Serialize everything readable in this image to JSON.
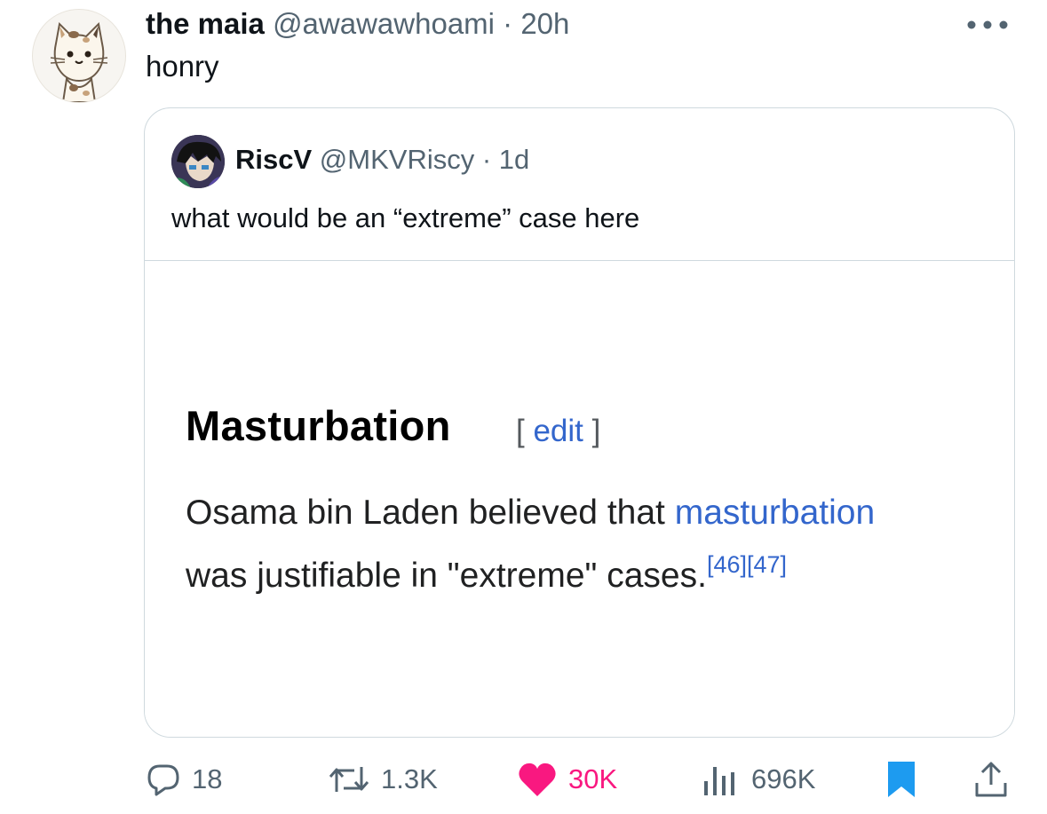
{
  "tweet": {
    "display_name": "the maia",
    "handle": "@awawawhoami",
    "separator": " · ",
    "time": "20h",
    "text": "honry",
    "avatar_icon": "cat-avatar-icon",
    "more_icon": "more-dots-icon"
  },
  "quoted": {
    "display_name": "RiscV",
    "handle": "@MKVRiscy",
    "separator": " · ",
    "time": "1d",
    "text": "what would be an “extreme” case here",
    "avatar_icon": "anime-avatar-icon",
    "image": {
      "heading": "Masturbation",
      "edit_open": "[ ",
      "edit_label": "edit",
      "edit_close": " ]",
      "line1_text": "Osama bin Laden believed that ",
      "line1_link": "masturbation",
      "line2_text": "was justifiable in \"extreme\" cases.",
      "refs": "[46][47]"
    }
  },
  "actions": {
    "reply_count": "18",
    "retweet_count": "1.3K",
    "like_count": "30K",
    "views_count": "696K",
    "like_color": "#f91880",
    "bookmark_color": "#1d9bf0",
    "icon_color": "#536471"
  }
}
